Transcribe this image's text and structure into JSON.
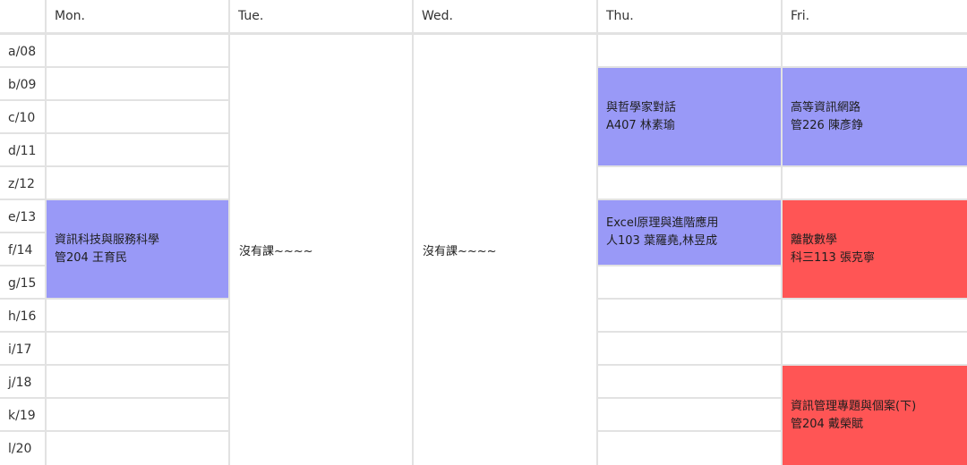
{
  "headers": {
    "corner": "",
    "mon": "Mon.",
    "tue": "Tue.",
    "wed": "Wed.",
    "thu": "Thu.",
    "fri": "Fri."
  },
  "periods": [
    "a/08",
    "b/09",
    "c/10",
    "d/11",
    "z/12",
    "e/13",
    "f/14",
    "g/15",
    "h/16",
    "i/17",
    "j/18",
    "k/19",
    "l/20"
  ],
  "no_class": {
    "tue": "沒有課~~~~",
    "wed": "沒有課~~~~"
  },
  "courses": {
    "mon_ef": {
      "name": "資訊科技與服務科學",
      "detail": "管204 王育民"
    },
    "thu_bd": {
      "name": "與哲學家對話",
      "detail": "A407 林素瑜"
    },
    "thu_ef": {
      "name": "Excel原理與進階應用",
      "detail": "人103 葉羅堯,林昱成"
    },
    "fri_bd": {
      "name": "高等資訊網路",
      "detail": "管226 陳彥錚"
    },
    "fri_eg": {
      "name": "離散數學",
      "detail": "科三113 張克寧"
    },
    "fri_jl": {
      "name": "資訊管理專題與個案(下)",
      "detail": "管204 戴榮賦"
    }
  },
  "colors": {
    "blue": "#9999f7",
    "red": "#ff5555",
    "grid": "#e2e2e2"
  }
}
